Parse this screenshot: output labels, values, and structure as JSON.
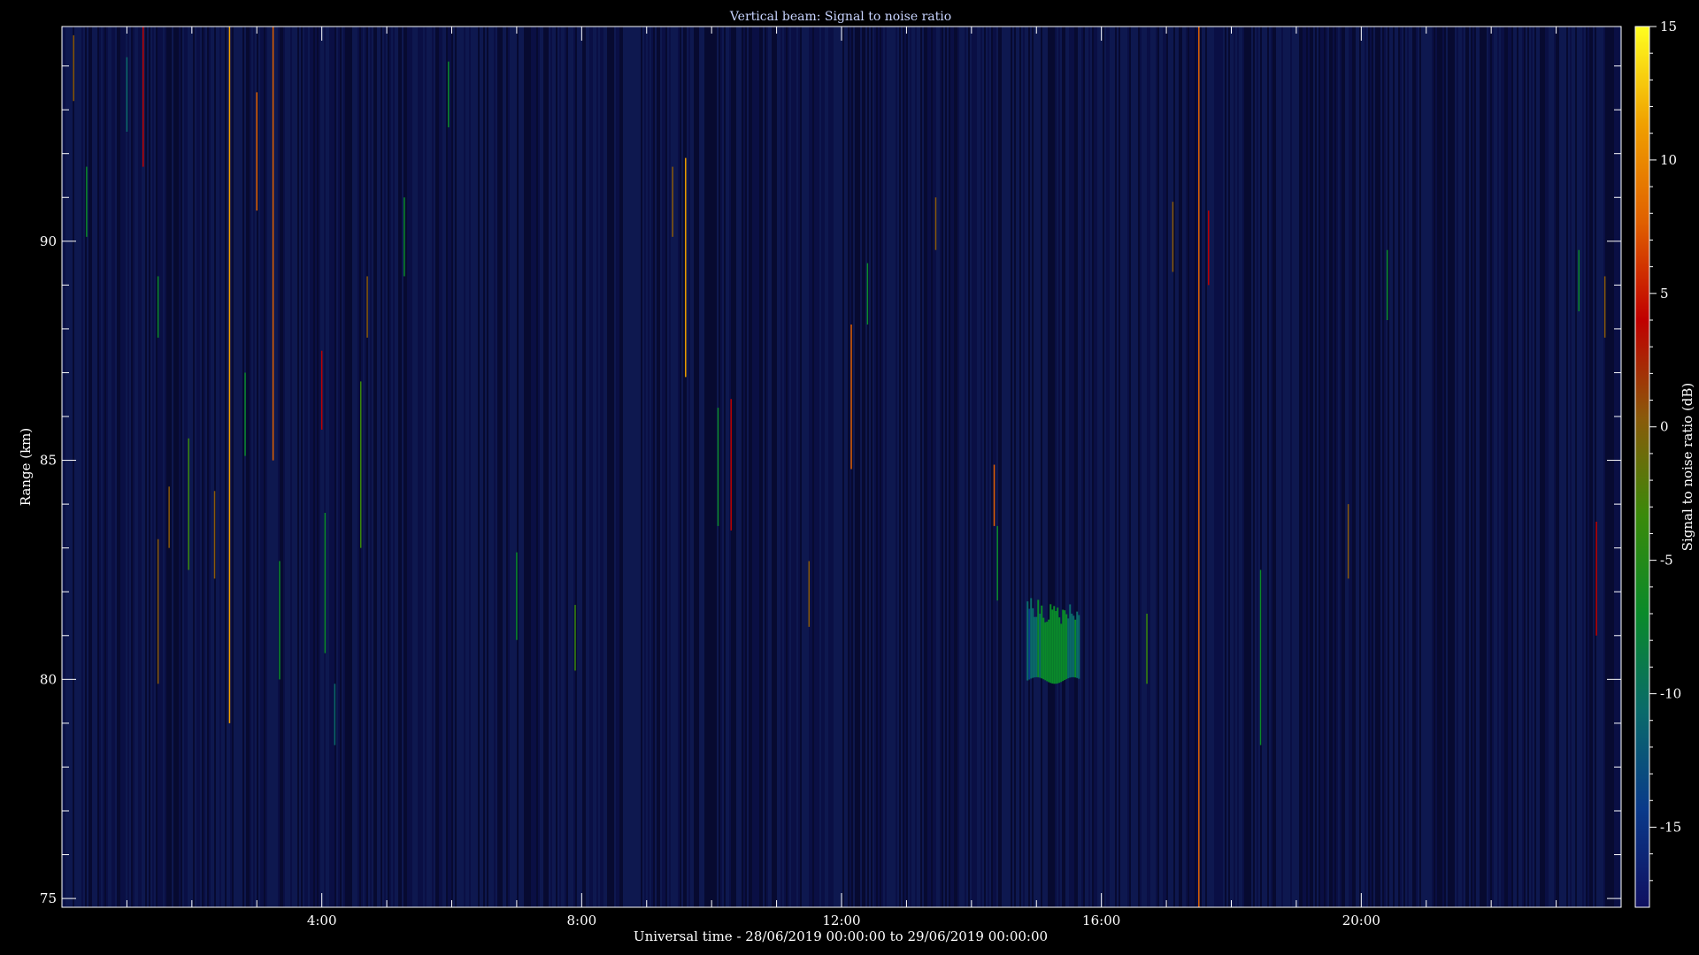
{
  "chart_data": {
    "type": "heatmap",
    "title": "Vertical beam: Signal to noise ratio",
    "xlabel": "Universal time - 28/06/2019 00:00:00 to 29/06/2019 00:00:00",
    "ylabel": "Range (km)",
    "xlim_hours": [
      0,
      24
    ],
    "ylim_km": [
      74.8,
      94.9
    ],
    "x_ticks": [
      {
        "hour": 4,
        "label": "4:00"
      },
      {
        "hour": 8,
        "label": "8:00"
      },
      {
        "hour": 12,
        "label": "12:00"
      },
      {
        "hour": 16,
        "label": "16:00"
      },
      {
        "hour": 20,
        "label": "20:00"
      }
    ],
    "y_ticks": [
      {
        "km": 75,
        "label": "75"
      },
      {
        "km": 80,
        "label": "80"
      },
      {
        "km": 85,
        "label": "85"
      },
      {
        "km": 90,
        "label": "90"
      }
    ],
    "colorbar": {
      "label": "Signal to noise ratio (dB)",
      "range_db": [
        -18,
        15
      ],
      "ticks": [
        {
          "db": 15,
          "label": "15"
        },
        {
          "db": 10,
          "label": "10"
        },
        {
          "db": 5,
          "label": "5"
        },
        {
          "db": 0,
          "label": "0"
        },
        {
          "db": -5,
          "label": "-5"
        },
        {
          "db": -10,
          "label": "-10"
        },
        {
          "db": -15,
          "label": "-15"
        }
      ],
      "colors": [
        "#101060",
        "#0a3a8a",
        "#0a6a6a",
        "#0a8a2a",
        "#3a8a0a",
        "#8a5a0a",
        "#c00000",
        "#e06000",
        "#f0a000",
        "#ffff20"
      ]
    },
    "background_color": "#0a0a3a",
    "echo_region": {
      "hour_start": 14.85,
      "hour_end": 15.65,
      "km_bottom": 79.9,
      "km_top": 82.1,
      "snr_db": -8
    },
    "streaks": [
      {
        "hour": 0.18,
        "km_start": 93.2,
        "km_end": 94.7,
        "snr_db": 2
      },
      {
        "hour": 0.38,
        "km_start": 90.1,
        "km_end": 91.7,
        "snr_db": -7
      },
      {
        "hour": 1.0,
        "km_start": 92.5,
        "km_end": 94.2,
        "snr_db": -9
      },
      {
        "hour": 1.25,
        "km_start": 91.7,
        "km_end": 94.9,
        "snr_db": 3
      },
      {
        "hour": 1.48,
        "km_start": 87.8,
        "km_end": 89.2,
        "snr_db": -6
      },
      {
        "hour": 1.48,
        "km_start": 79.9,
        "km_end": 83.2,
        "snr_db": 1
      },
      {
        "hour": 1.65,
        "km_start": 83.0,
        "km_end": 84.4,
        "snr_db": 2
      },
      {
        "hour": 1.95,
        "km_start": 82.5,
        "km_end": 85.5,
        "snr_db": -4
      },
      {
        "hour": 2.35,
        "km_start": 82.3,
        "km_end": 84.3,
        "snr_db": 1
      },
      {
        "hour": 2.58,
        "km_start": 79.0,
        "km_end": 94.9,
        "snr_db": 10
      },
      {
        "hour": 2.82,
        "km_start": 85.1,
        "km_end": 87.0,
        "snr_db": -7
      },
      {
        "hour": 3.0,
        "km_start": 90.7,
        "km_end": 93.4,
        "snr_db": 6
      },
      {
        "hour": 3.25,
        "km_start": 85.0,
        "km_end": 94.9,
        "snr_db": 9
      },
      {
        "hour": 3.35,
        "km_start": 80.0,
        "km_end": 82.7,
        "snr_db": -8
      },
      {
        "hour": 4.0,
        "km_start": 85.7,
        "km_end": 87.5,
        "snr_db": 4
      },
      {
        "hour": 4.05,
        "km_start": 80.6,
        "km_end": 83.8,
        "snr_db": -6
      },
      {
        "hour": 4.2,
        "km_start": 78.5,
        "km_end": 79.9,
        "snr_db": -9
      },
      {
        "hour": 4.6,
        "km_start": 83.0,
        "km_end": 86.8,
        "snr_db": -5
      },
      {
        "hour": 4.7,
        "km_start": 87.8,
        "km_end": 89.2,
        "snr_db": 1
      },
      {
        "hour": 5.27,
        "km_start": 89.2,
        "km_end": 91.0,
        "snr_db": -6
      },
      {
        "hour": 5.95,
        "km_start": 92.6,
        "km_end": 94.1,
        "snr_db": -7
      },
      {
        "hour": 7.0,
        "km_start": 80.9,
        "km_end": 82.9,
        "snr_db": -8
      },
      {
        "hour": 7.9,
        "km_start": 80.2,
        "km_end": 81.7,
        "snr_db": -5
      },
      {
        "hour": 9.4,
        "km_start": 90.1,
        "km_end": 91.7,
        "snr_db": 2
      },
      {
        "hour": 9.6,
        "km_start": 86.9,
        "km_end": 91.9,
        "snr_db": 12
      },
      {
        "hour": 10.1,
        "km_start": 83.5,
        "km_end": 86.2,
        "snr_db": -8
      },
      {
        "hour": 10.3,
        "km_start": 83.4,
        "km_end": 86.4,
        "snr_db": 4
      },
      {
        "hour": 11.5,
        "km_start": 81.2,
        "km_end": 82.7,
        "snr_db": 2
      },
      {
        "hour": 12.15,
        "km_start": 84.8,
        "km_end": 88.1,
        "snr_db": 6
      },
      {
        "hour": 12.4,
        "km_start": 88.1,
        "km_end": 89.5,
        "snr_db": -6
      },
      {
        "hour": 13.45,
        "km_start": 89.8,
        "km_end": 91.0,
        "snr_db": 1
      },
      {
        "hour": 14.35,
        "km_start": 83.5,
        "km_end": 84.9,
        "snr_db": 6
      },
      {
        "hour": 14.4,
        "km_start": 81.8,
        "km_end": 83.5,
        "snr_db": -6
      },
      {
        "hour": 16.7,
        "km_start": 79.9,
        "km_end": 81.5,
        "snr_db": -5
      },
      {
        "hour": 17.1,
        "km_start": 89.3,
        "km_end": 90.9,
        "snr_db": 2
      },
      {
        "hour": 17.5,
        "km_start": 74.8,
        "km_end": 94.9,
        "snr_db": 6
      },
      {
        "hour": 17.65,
        "km_start": 89.0,
        "km_end": 90.7,
        "snr_db": 3
      },
      {
        "hour": 18.45,
        "km_start": 78.5,
        "km_end": 82.5,
        "snr_db": -7
      },
      {
        "hour": 19.8,
        "km_start": 82.3,
        "km_end": 84.0,
        "snr_db": 2
      },
      {
        "hour": 20.4,
        "km_start": 88.2,
        "km_end": 89.8,
        "snr_db": -6
      },
      {
        "hour": 23.35,
        "km_start": 88.4,
        "km_end": 89.8,
        "snr_db": -7
      },
      {
        "hour": 23.62,
        "km_start": 81.0,
        "km_end": 83.6,
        "snr_db": 3
      },
      {
        "hour": 23.75,
        "km_start": 87.8,
        "km_end": 89.2,
        "snr_db": 1
      }
    ]
  }
}
